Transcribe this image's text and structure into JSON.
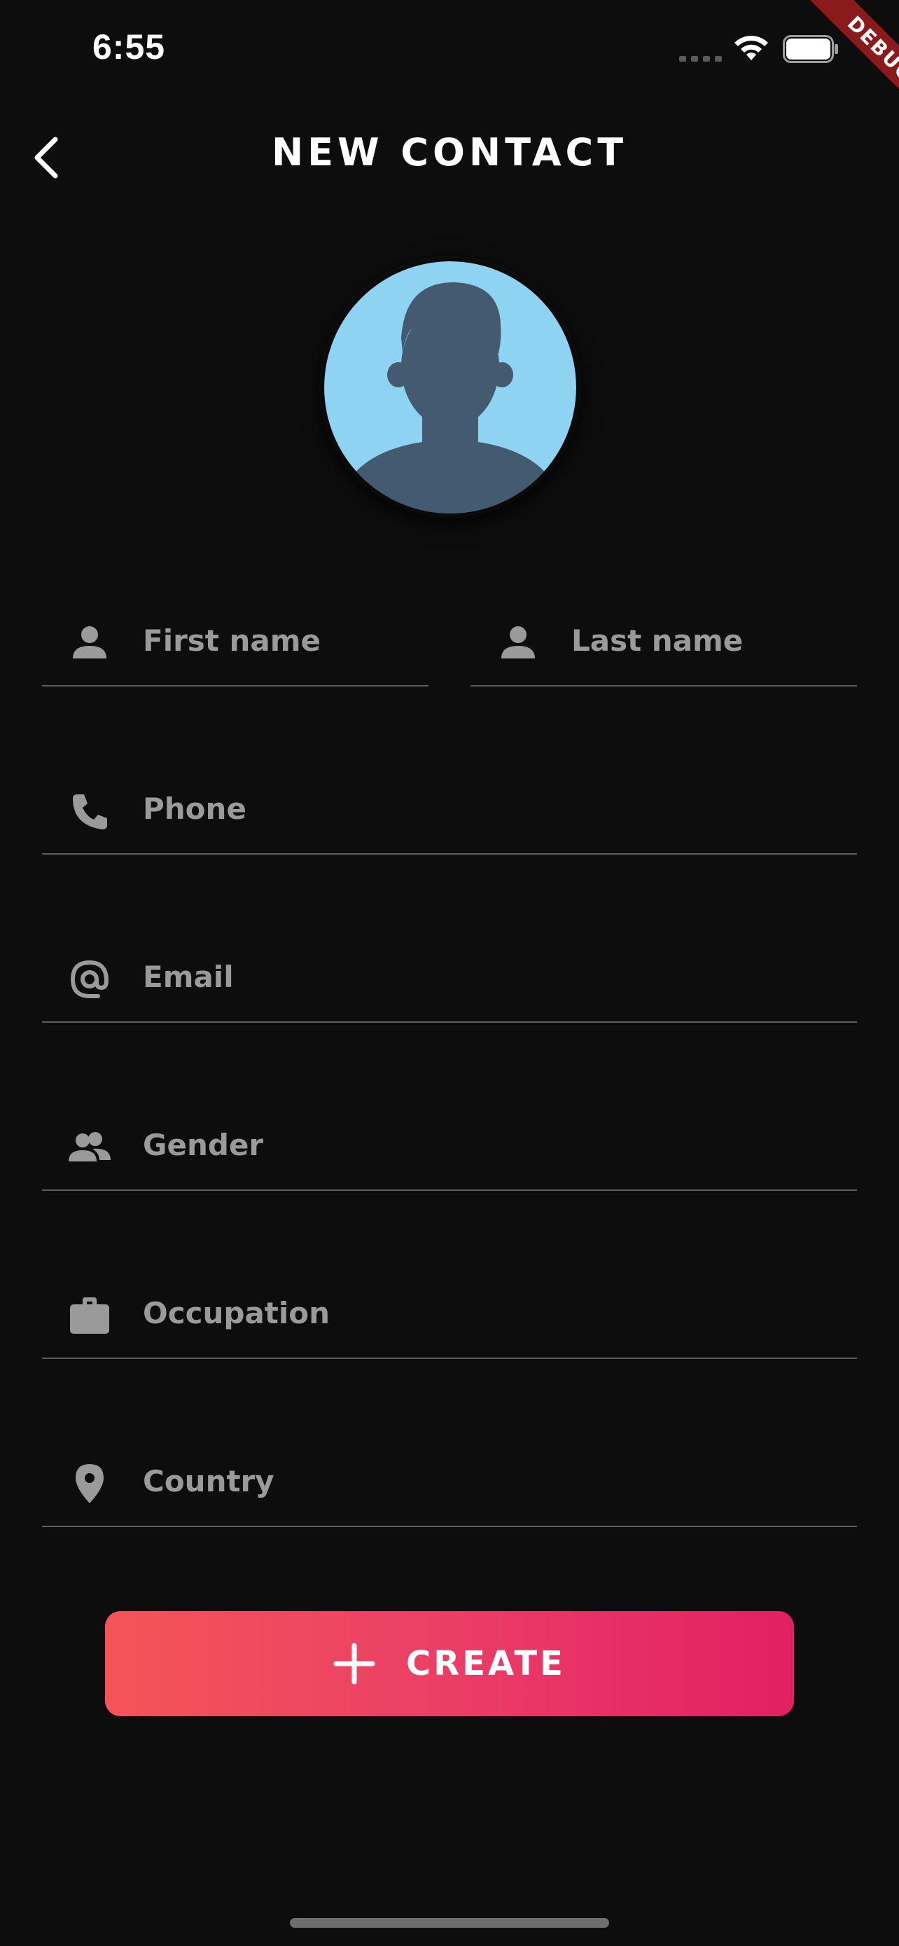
{
  "status_bar": {
    "time": "6:55",
    "debug_label": "DEBUG"
  },
  "header": {
    "title": "NEW CONTACT",
    "back_icon": "chevron-left-icon"
  },
  "avatar": {
    "icon": "person-silhouette-icon",
    "colors": {
      "background": "#8fd3f3",
      "silhouette": "#435a71"
    }
  },
  "form": {
    "first_name": {
      "placeholder": "First name",
      "icon": "person-icon"
    },
    "last_name": {
      "placeholder": "Last name",
      "icon": "person-icon"
    },
    "phone": {
      "placeholder": "Phone",
      "icon": "phone-icon"
    },
    "email": {
      "placeholder": "Email",
      "icon": "at-sign-icon"
    },
    "gender": {
      "placeholder": "Gender",
      "icon": "people-icon"
    },
    "occupation": {
      "placeholder": "Occupation",
      "icon": "briefcase-icon"
    },
    "country": {
      "placeholder": "Country",
      "icon": "location-pin-icon"
    }
  },
  "create_button": {
    "label": "CREATE",
    "icon": "plus-icon",
    "gradient": [
      "#f45557",
      "#e21f63"
    ]
  },
  "theme": {
    "background": "#0d0d0d",
    "placeholder_color": "#9a9a9a",
    "divider_color": "#5c5c5c"
  }
}
